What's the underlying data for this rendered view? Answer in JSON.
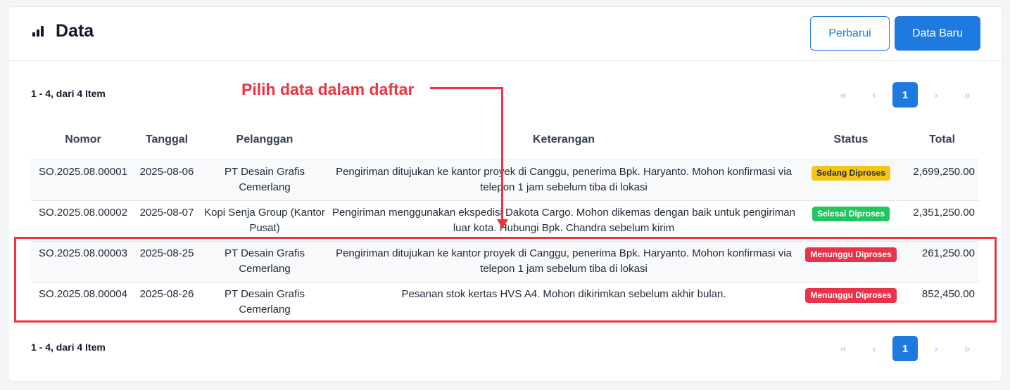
{
  "header": {
    "title": "Data",
    "refresh_label": "Perbarui",
    "new_label": "Data Baru"
  },
  "list": {
    "range_text": "1 - 4, dari 4 Item",
    "pagination": {
      "first": "«",
      "prev": "‹",
      "current": "1",
      "next": "›",
      "last": "»"
    },
    "columns": [
      "Nomor",
      "Tanggal",
      "Pelanggan",
      "Keterangan",
      "Status",
      "Total"
    ],
    "rows": [
      {
        "nomor": "SO.2025.08.00001",
        "tanggal": "2025-08-06",
        "pelanggan": "PT Desain Grafis Cemerlang",
        "keterangan": "Pengiriman ditujukan ke kantor proyek di Canggu, penerima Bpk. Haryanto. Mohon konfirmasi via telepon 1 jam sebelum tiba di lokasi",
        "status": "Sedang Diproses",
        "total": "2,699,250.00"
      },
      {
        "nomor": "SO.2025.08.00002",
        "tanggal": "2025-08-07",
        "pelanggan": "Kopi Senja Group (Kantor Pusat)",
        "keterangan": "Pengiriman menggunakan ekspedisi Dakota Cargo. Mohon dikemas dengan baik untuk pengiriman luar kota. Hubungi Bpk. Chandra sebelum kirim",
        "status": "Selesai Diproses",
        "total": "2,351,250.00"
      },
      {
        "nomor": "SO.2025.08.00003",
        "tanggal": "2025-08-25",
        "pelanggan": "PT Desain Grafis Cemerlang",
        "keterangan": "Pengiriman ditujukan ke kantor proyek di Canggu, penerima Bpk. Haryanto. Mohon konfirmasi via telepon 1 jam sebelum tiba di lokasi",
        "status": "Menunggu Diproses",
        "total": "261,250.00"
      },
      {
        "nomor": "SO.2025.08.00004",
        "tanggal": "2025-08-26",
        "pelanggan": "PT Desain Grafis Cemerlang",
        "keterangan": "Pesanan stok kertas HVS A4. Mohon dikirimkan sebelum akhir bulan.",
        "status": "Menunggu Diproses",
        "total": "852,450.00"
      }
    ]
  },
  "annotation": {
    "text": "Pilih data dalam daftar"
  },
  "colors": {
    "primary": "#1f7ae0",
    "annotation": "#ef3340",
    "status_sedang": "#f5c518",
    "status_selesai": "#22c55e",
    "status_menunggu": "#e8334a"
  }
}
